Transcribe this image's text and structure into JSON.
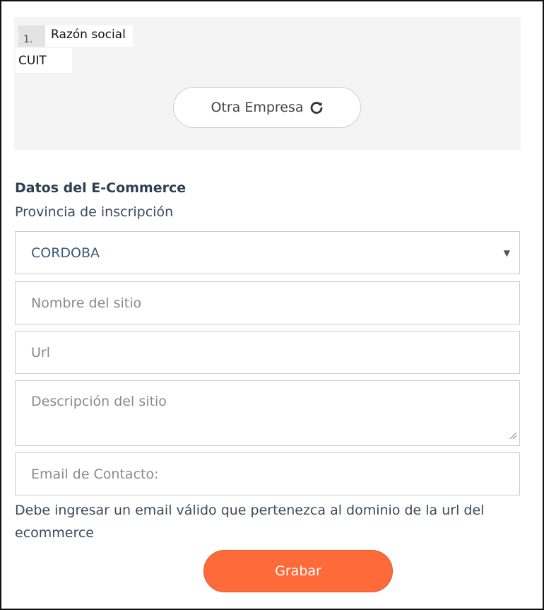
{
  "company": {
    "number": "1.",
    "razon_social_label": "Razón social",
    "cuit_label": "CUIT",
    "otra_empresa_button": "Otra Empresa",
    "reload_icon": "reload-icon"
  },
  "ecommerce": {
    "section_title": "Datos del E-Commerce",
    "provincia_label": "Provincia de inscripción",
    "provincia_selected": "CORDOBA",
    "nombre_placeholder": "Nombre del sitio",
    "url_placeholder": "Url",
    "descripcion_placeholder": "Descripción del sitio",
    "email_placeholder": "Email de Contacto:",
    "email_hint": "Debe ingresar un email válido que pertenezca al dominio de la url del ecommerce",
    "grabar_button": "Grabar"
  },
  "colors": {
    "primary_button": "#ff6a3a",
    "heading": "#2d3e50",
    "panel_bg": "#f4f4f4"
  }
}
